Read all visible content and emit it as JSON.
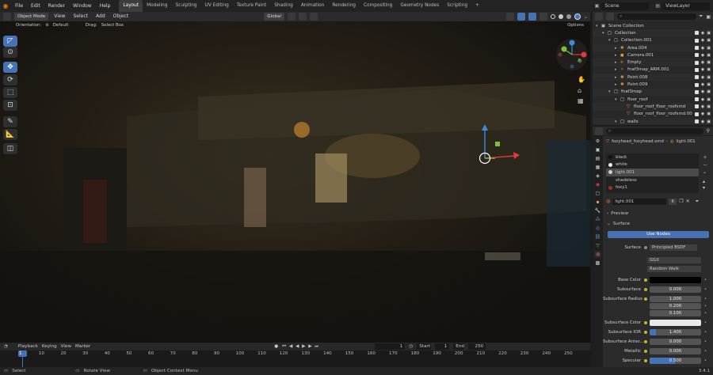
{
  "topbar": {
    "menus": [
      "File",
      "Edit",
      "Render",
      "Window",
      "Help"
    ],
    "workspaces": [
      "Layout",
      "Modeling",
      "Sculpting",
      "UV Editing",
      "Texture Paint",
      "Shading",
      "Animation",
      "Rendering",
      "Compositing",
      "Geometry Nodes",
      "Scripting"
    ],
    "active_workspace": "Layout",
    "add_tab": "+",
    "scene": "Scene",
    "view_layer": "ViewLayer"
  },
  "viewport_header": {
    "mode": "Object Mode",
    "menus": [
      "View",
      "Select",
      "Add",
      "Object"
    ],
    "transform": "Global",
    "orientation_label": "Orientation:",
    "orientation_value": "Default",
    "drag_label": "Drag:",
    "drag_value": "Select Box",
    "options": "Options"
  },
  "gizmo": {
    "x": "X",
    "y": "Y",
    "z": "Z"
  },
  "timeline": {
    "menus": [
      "Playback",
      "Keying",
      "View",
      "Marker"
    ],
    "current_frame": "1",
    "start_label": "Start",
    "start": "1",
    "end_label": "End",
    "end": "250",
    "ticks": [
      "1",
      "10",
      "20",
      "30",
      "40",
      "50",
      "60",
      "70",
      "80",
      "90",
      "100",
      "110",
      "120",
      "130",
      "140",
      "150",
      "160",
      "170",
      "180",
      "190",
      "200",
      "210",
      "220",
      "230",
      "240",
      "250"
    ]
  },
  "status": {
    "select": "Select",
    "rotate": "Rotate View",
    "context": "Object Context Menu",
    "version": "3.4.1"
  },
  "outliner": {
    "items": [
      {
        "name": "Scene Collection",
        "depth": 0,
        "icon": "scene"
      },
      {
        "name": "Collection",
        "depth": 1,
        "icon": "collection"
      },
      {
        "name": "Collection.001",
        "depth": 2,
        "icon": "collection"
      },
      {
        "name": "Area.004",
        "depth": 3,
        "icon": "light"
      },
      {
        "name": "Camera.001",
        "depth": 3,
        "icon": "camera"
      },
      {
        "name": "Empty",
        "depth": 3,
        "icon": "empty"
      },
      {
        "name": "fnaf3map_ARM.001",
        "depth": 3,
        "icon": "armature"
      },
      {
        "name": "Point.008",
        "depth": 3,
        "icon": "light"
      },
      {
        "name": "Point.009",
        "depth": 3,
        "icon": "light"
      },
      {
        "name": "fnaf3map",
        "depth": 2,
        "icon": "collection"
      },
      {
        "name": "floor_roof",
        "depth": 3,
        "icon": "collection"
      },
      {
        "name": "floor_roof_floor_roofsmd",
        "depth": 4,
        "icon": "mesh"
      },
      {
        "name": "floor_roof_floor_roofsmd.00",
        "depth": 4,
        "icon": "mesh"
      },
      {
        "name": "walls",
        "depth": 3,
        "icon": "collection"
      }
    ]
  },
  "properties": {
    "breadcrumb_object": "foxyhead_foxyhead.smd",
    "breadcrumb_material": "light.001",
    "slots": [
      "black",
      "white",
      "light.001",
      "shadeless",
      "foxy1"
    ],
    "active_slot": "light.001",
    "material_name": "light.001",
    "users": "6",
    "preview": "Preview",
    "surface_panel": "Surface",
    "use_nodes": "Use Nodes",
    "surface_label": "Surface",
    "surface_value": "Principled BSDF",
    "distribution": "GGX",
    "subsurface_method": "Random Walk",
    "fields": [
      {
        "label": "Base Color",
        "type": "color",
        "color": "#000000"
      },
      {
        "label": "Subsurface",
        "value": "0.000"
      },
      {
        "label": "Subsurface Radius",
        "value": "1.000"
      },
      {
        "label": "",
        "value": "0.200"
      },
      {
        "label": "",
        "value": "0.100"
      },
      {
        "label": "Subsurface Color",
        "type": "color",
        "color": "#e8e8e8"
      },
      {
        "label": "Subsurface IOR",
        "value": "1.400"
      },
      {
        "label": "Subsurface Aniso...",
        "value": "0.000"
      },
      {
        "label": "Metallic",
        "value": "0.000"
      },
      {
        "label": "Specular",
        "value": "0.500"
      }
    ]
  },
  "colors": {
    "accent": "#4772b3",
    "x_axis": "#e0393f",
    "y_axis": "#7cbf3a",
    "z_axis": "#3d8bd9"
  }
}
